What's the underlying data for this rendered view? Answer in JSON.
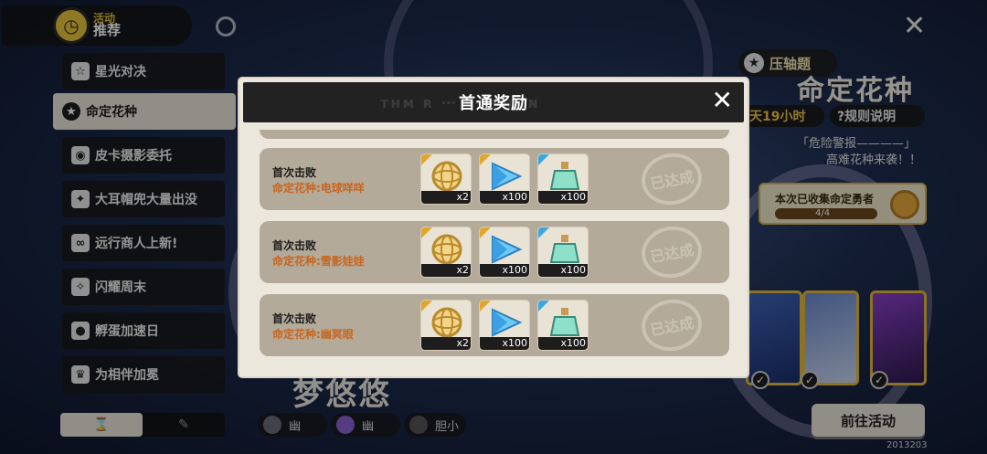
{
  "activity": {
    "sub": "活动",
    "main": "推荐"
  },
  "sidebar": {
    "items": [
      {
        "label": "星光对决",
        "icon": "star-duel-icon"
      },
      {
        "label": "命定花种",
        "icon": "fate-flower-icon",
        "active": true
      },
      {
        "label": "皮卡摄影委托",
        "icon": "camera-icon"
      },
      {
        "label": "大耳帽兜大量出没",
        "icon": "hood-icon"
      },
      {
        "label": "远行商人上新!",
        "icon": "merchant-icon"
      },
      {
        "label": "闪耀周末",
        "icon": "shine-icon"
      },
      {
        "label": "孵蛋加速日",
        "icon": "egg-icon"
      },
      {
        "label": "为相伴加冕",
        "icon": "crown-icon"
      }
    ],
    "tabs": [
      {
        "label": "⌛",
        "icon": "hourglass-icon",
        "active": true
      },
      {
        "label": "✎",
        "icon": "feather-icon",
        "active": false
      }
    ]
  },
  "event": {
    "badge": "压轴题",
    "title": "命定花种",
    "timer": "天19小时",
    "rules": "?规则说明",
    "quote1": "「危险警报————」",
    "quote2": "高难花种来袭！！",
    "collect_title": "本次已收集命定勇者",
    "collect_count": "4/4",
    "goto": "前往活动",
    "footer_code": "2013203"
  },
  "monster": {
    "name": "梦悠悠",
    "traits": [
      {
        "label": "幽",
        "color": "#6b6b7a"
      },
      {
        "label": "幽",
        "color": "#8a5fd0"
      },
      {
        "label": "胆小",
        "color": "#555555"
      }
    ]
  },
  "modal": {
    "title": "首通奖励",
    "ghost": "ᴛʜᴍ ʀ ⋯ ⋯ +ʜᴍɴ",
    "close": "✕",
    "rows": [
      {
        "title": "首次击败",
        "sub": "命定花种:电球咩咩",
        "stamp": "已达成",
        "rewards": [
          {
            "icon": "gyro-orb-icon",
            "count": "x2",
            "tag": "gold"
          },
          {
            "icon": "crystal-icon",
            "count": "x100",
            "tag": "gold"
          },
          {
            "icon": "potion-icon",
            "count": "x100",
            "tag": "blue"
          }
        ]
      },
      {
        "title": "首次击败",
        "sub": "命定花种:雪影娃娃",
        "stamp": "已达成",
        "rewards": [
          {
            "icon": "gyro-orb-icon",
            "count": "x2",
            "tag": "gold"
          },
          {
            "icon": "crystal-icon",
            "count": "x100",
            "tag": "gold"
          },
          {
            "icon": "potion-icon",
            "count": "x100",
            "tag": "blue"
          }
        ]
      },
      {
        "title": "首次击败",
        "sub": "命定花种:幽冥眼",
        "stamp": "已达成",
        "rewards": [
          {
            "icon": "gyro-orb-icon",
            "count": "x2",
            "tag": "gold"
          },
          {
            "icon": "crystal-icon",
            "count": "x100",
            "tag": "gold"
          },
          {
            "icon": "potion-icon",
            "count": "x100",
            "tag": "blue"
          }
        ]
      }
    ]
  }
}
